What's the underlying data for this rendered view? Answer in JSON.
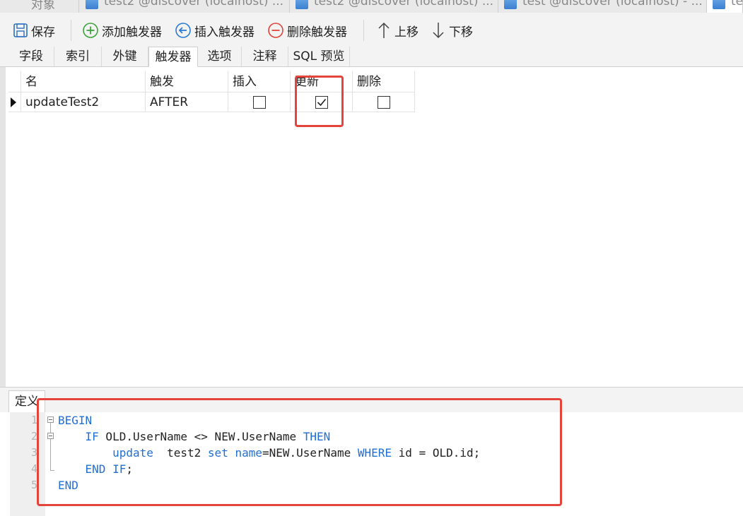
{
  "doc_tabs": [
    {
      "label": "对象"
    },
    {
      "label": "test2 @discover (localhost) ..."
    },
    {
      "label": "test2 @discover (localhost) ..."
    },
    {
      "label": "test @discover (localhost) - ..."
    },
    {
      "label": "te"
    }
  ],
  "toolbar": {
    "save": "保存",
    "add_trigger": "添加触发器",
    "insert_trigger": "插入触发器",
    "delete_trigger": "删除触发器",
    "move_up": "上移",
    "move_down": "下移"
  },
  "designer_tabs": [
    {
      "label": "字段"
    },
    {
      "label": "索引"
    },
    {
      "label": "外键"
    },
    {
      "label": "触发器",
      "active": true
    },
    {
      "label": "选项"
    },
    {
      "label": "注释"
    },
    {
      "label": "SQL 预览"
    }
  ],
  "grid": {
    "columns": [
      "名",
      "触发",
      "插入",
      "更新",
      "删除"
    ],
    "rows": [
      {
        "name": "updateTest2",
        "timing": "AFTER",
        "insert": false,
        "update": true,
        "delete": false
      }
    ]
  },
  "definition": {
    "tab_label": "定义",
    "lines": [
      {
        "num": "1",
        "parts": [
          {
            "t": "BEGIN",
            "kw": true
          }
        ]
      },
      {
        "num": "2",
        "parts": [
          {
            "t": "    "
          },
          {
            "t": "IF",
            "kw": true
          },
          {
            "t": " OLD.UserName <> NEW.UserName "
          },
          {
            "t": "THEN",
            "kw": true
          }
        ]
      },
      {
        "num": "3",
        "parts": [
          {
            "t": "        "
          },
          {
            "t": "update",
            "kw": true
          },
          {
            "t": "  test2 "
          },
          {
            "t": "set",
            "kw": true
          },
          {
            "t": " "
          },
          {
            "t": "name",
            "kw": true
          },
          {
            "t": "=NEW.UserName "
          },
          {
            "t": "WHERE",
            "kw": true
          },
          {
            "t": " id = OLD.id;"
          }
        ]
      },
      {
        "num": "4",
        "parts": [
          {
            "t": "    "
          },
          {
            "t": "END IF",
            "kw": true
          },
          {
            "t": ";"
          }
        ]
      },
      {
        "num": "5",
        "parts": [
          {
            "t": "END",
            "kw": true
          }
        ]
      }
    ]
  },
  "colors": {
    "highlight": "#e5443b",
    "keyword": "#1f6fd6",
    "add_icon": "#3aa53a",
    "insert_icon": "#2b7bd3",
    "delete_icon": "#e0443a"
  }
}
